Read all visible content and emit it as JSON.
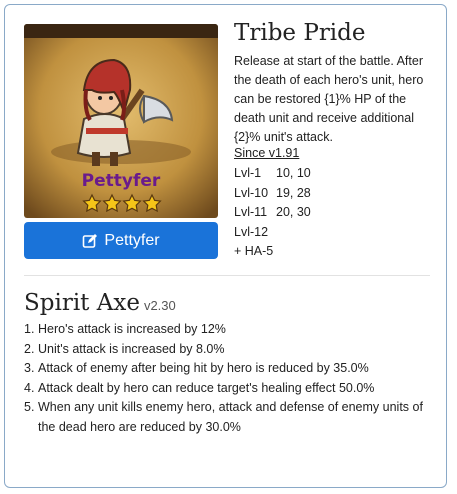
{
  "hero": {
    "name_on_portrait": "Pettyfer",
    "stars": 4,
    "button_label": "Pettyfer"
  },
  "skill": {
    "title": "Tribe Pride",
    "description": "Release at start of the battle. After the death of each hero's unit, hero can be restored {1}% HP of the death unit and receive additional {2}% unit's attack.",
    "version": "Since v1.91",
    "levels": [
      {
        "label": "Lvl-1",
        "value": "10, 10"
      },
      {
        "label": "Lvl-10",
        "value": "19, 28"
      },
      {
        "label": "Lvl-11",
        "value": "20, 30"
      },
      {
        "label": "Lvl-12",
        "value": ""
      },
      {
        "label": "+ HA-5",
        "value": ""
      }
    ]
  },
  "weapon": {
    "name": "Spirit Axe",
    "version": "v2.30",
    "effects": [
      "Hero's attack is increased by 12%",
      "Unit's attack is increased by 8.0%",
      "Attack of enemy after being hit by hero is reduced by 35.0%",
      "Attack dealt by hero can reduce target's healing effect 50.0%",
      "When any unit kills enemy hero, attack and defense of enemy units of the dead hero are reduced by 30.0%"
    ]
  },
  "colors": {
    "button": "#1a73d9",
    "portrait_bg": "#c79a4f",
    "star": "#f5c518",
    "hero_name": "#6a1b8c"
  }
}
